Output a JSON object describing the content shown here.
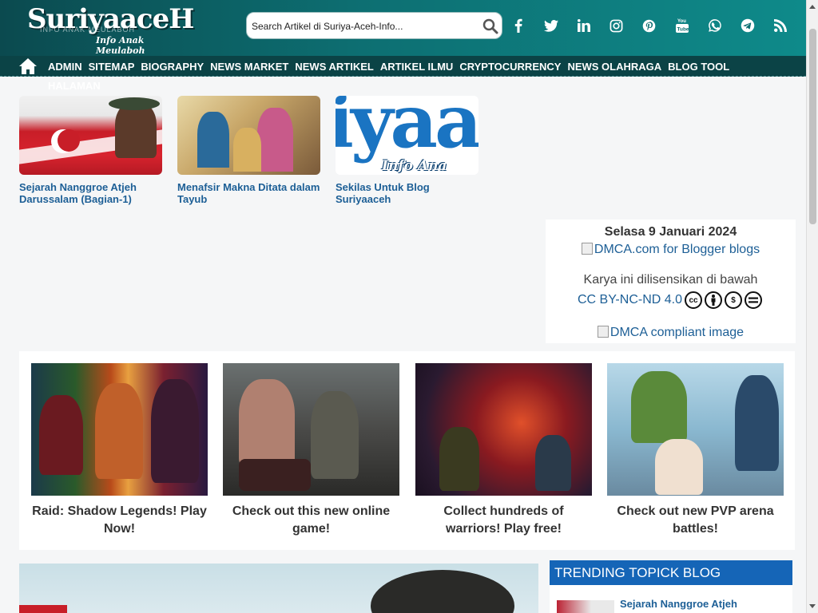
{
  "header": {
    "logo_text": "SuriyaaceH",
    "logo_tagline": "Info Anak Meulaboh",
    "logo_faint": "INFO ANAK MEULABOH",
    "search_placeholder": "Search Artikel di Suriya-Aceh-Info..."
  },
  "social_icons": [
    "facebook-icon",
    "twitter-icon",
    "linkedin-icon",
    "instagram-icon",
    "pinterest-icon",
    "youtube-icon",
    "whatsapp-icon",
    "telegram-icon",
    "rss-icon"
  ],
  "nav": {
    "items": [
      "ADMIN",
      "SITEMAP",
      "BIOGRAPHY",
      "NEWS MARKET",
      "NEWS ARTIKEL",
      "ARTIKEL ILMU",
      "CRYPTOCURRENCY",
      "NEWS OLAHRAGA",
      "BLOG TOOL"
    ],
    "overflow_item": "HALAMAN"
  },
  "related": [
    {
      "title": "Sejarah Nanggroe Atjeh Darussalam (Bagian-1)"
    },
    {
      "title": "Menafsir Makna Ditata dalam Tayub"
    },
    {
      "title": "Sekilas Untuk Blog Suriyaaceh"
    }
  ],
  "infobox": {
    "date": "Selasa 9 Januari 2024",
    "dmca_badge_alt": "DMCA.com for Blogger blogs",
    "license_text": "Karya ini dilisensikan di bawah",
    "license_link": "CC BY-NC-ND 4.0",
    "dmca_image_alt": "DMCA compliant image"
  },
  "ads": [
    {
      "caption": "Raid: Shadow Legends! Play Now!"
    },
    {
      "caption": "Check out this new online game!"
    },
    {
      "caption": "Collect hundreds of warriors! Play free!"
    },
    {
      "caption": "Check out new PVP arena battles!"
    }
  ],
  "trending": {
    "heading": "TRENDING TOPICK BLOG",
    "first_item": "Sejarah Nanggroe Atjeh"
  },
  "colors": {
    "header_bg": "#0d6f72",
    "nav_bg": "#0b4346",
    "link": "#1d5f96",
    "trending_bg": "#1565b7"
  }
}
